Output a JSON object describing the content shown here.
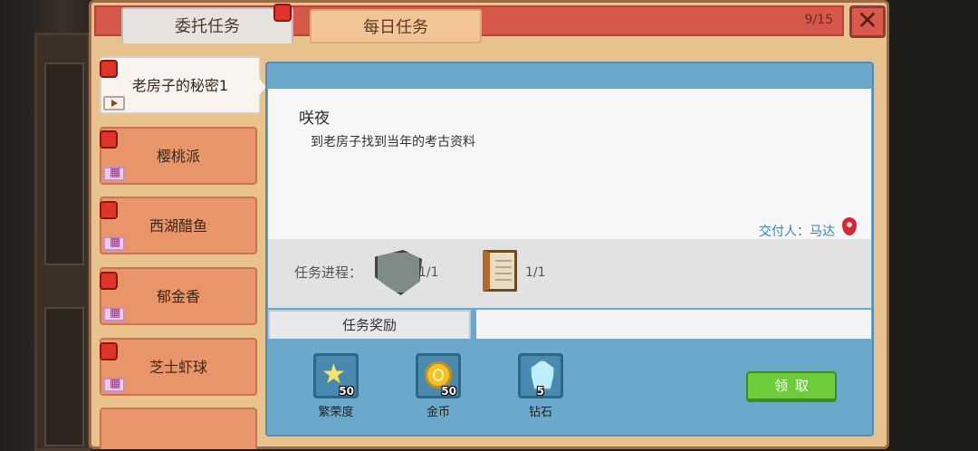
{
  "header": {
    "tabs": [
      {
        "label": "委托任务",
        "active": true
      },
      {
        "label": "每日任务",
        "active": false
      }
    ],
    "counter": "9/15",
    "close_icon": "close-x-icon"
  },
  "quest_list": [
    {
      "label": "老房子的秘密1",
      "badge": "flag-icon",
      "selected": true
    },
    {
      "label": "樱桃派",
      "badge": "calendar-icon",
      "selected": false
    },
    {
      "label": "西湖醋鱼",
      "badge": "calendar-icon",
      "selected": false
    },
    {
      "label": "郁金香",
      "badge": "calendar-icon",
      "selected": false
    },
    {
      "label": "芝士虾球",
      "badge": "calendar-icon",
      "selected": false
    }
  ],
  "detail": {
    "npc_name": "咲夜",
    "description": "到老房子找到当年的考古资料",
    "giver_label": "交付人：马达",
    "progress_label": "任务进程：",
    "progress_items": [
      {
        "icon": "stone-tablet-icon",
        "count": "1/1"
      },
      {
        "icon": "book-icon",
        "count": "1/1"
      }
    ]
  },
  "rewards": {
    "title": "任务奖励",
    "items": [
      {
        "icon": "star-icon",
        "qty": "50",
        "label": "繁荣度"
      },
      {
        "icon": "gold-coin-icon",
        "qty": "50",
        "label": "金币"
      },
      {
        "icon": "diamond-icon",
        "qty": "5",
        "label": "钻石"
      }
    ],
    "claim_label": "领取"
  },
  "colors": {
    "title_bar": "#d4594b",
    "panel": "#e8c38e",
    "detail_panel": "#6aa8cc",
    "claim_button": "#6ccc3a",
    "list_item": "#e8956a"
  }
}
